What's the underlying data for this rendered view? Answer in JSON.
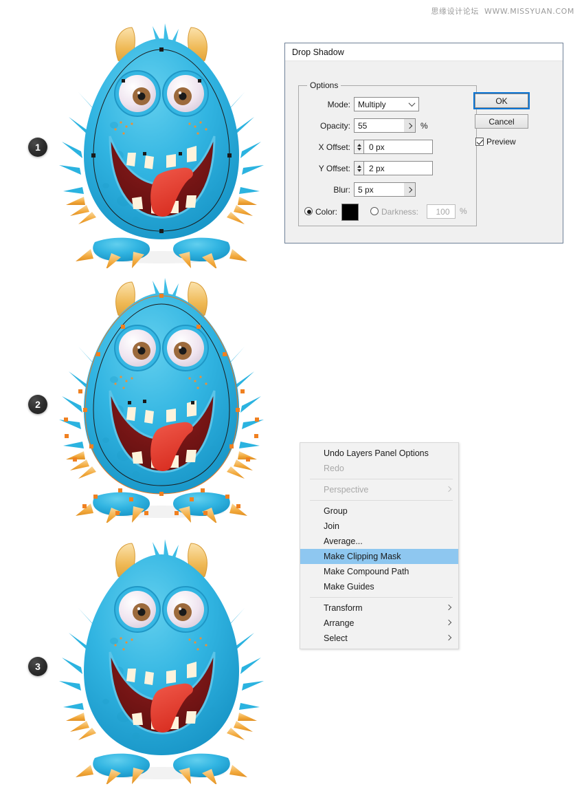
{
  "watermark": {
    "cn": "思缘设计论坛",
    "url": "WWW.MISSYUAN.COM"
  },
  "steps": [
    {
      "number": "1"
    },
    {
      "number": "2"
    },
    {
      "number": "3"
    }
  ],
  "dialog": {
    "title": "Drop Shadow",
    "group_legend": "Options",
    "fields": {
      "mode_label": "Mode:",
      "mode_value": "Multiply",
      "opacity_label": "Opacity:",
      "opacity_value": "55",
      "opacity_unit": "%",
      "xoffset_label": "X Offset:",
      "xoffset_value": "0 px",
      "yoffset_label": "Y Offset:",
      "yoffset_value": "2 px",
      "blur_label": "Blur:",
      "blur_value": "5 px",
      "color_label": "Color:",
      "color_swatch": "#000000",
      "darkness_label": "Darkness:",
      "darkness_value": "100",
      "darkness_unit": "%"
    },
    "buttons": {
      "ok": "OK",
      "cancel": "Cancel",
      "preview": "Preview"
    },
    "accent": "#0a74d4"
  },
  "context_menu": {
    "highlight_color": "#8ec7f0",
    "items": [
      {
        "label": "Undo Layers Panel Options",
        "state": "normal",
        "submenu": false
      },
      {
        "label": "Redo",
        "state": "disabled",
        "submenu": false
      },
      {
        "separator": true
      },
      {
        "label": "Perspective",
        "state": "disabled",
        "submenu": true
      },
      {
        "separator": true
      },
      {
        "label": "Group",
        "state": "normal",
        "submenu": false
      },
      {
        "label": "Join",
        "state": "normal",
        "submenu": false
      },
      {
        "label": "Average...",
        "state": "normal",
        "submenu": false
      },
      {
        "label": "Make Clipping Mask",
        "state": "selected",
        "submenu": false
      },
      {
        "label": "Make Compound Path",
        "state": "normal",
        "submenu": false
      },
      {
        "label": "Make Guides",
        "state": "normal",
        "submenu": false
      },
      {
        "separator": true
      },
      {
        "label": "Transform",
        "state": "normal",
        "submenu": true
      },
      {
        "label": "Arrange",
        "state": "normal",
        "submenu": true
      },
      {
        "label": "Select",
        "state": "normal",
        "submenu": true
      }
    ]
  },
  "artwork": {
    "subject": "blue-furry-monster",
    "colors": {
      "body_light": "#4fc3e8",
      "body_mid": "#2bb3e0",
      "body_dark": "#1a9ac9",
      "horn": "#f0b95a",
      "horn_light": "#f7d89a",
      "claw": "#f2a93c",
      "mouth": "#7a1515",
      "tongue": "#e8362c",
      "tooth": "#fdf3dc",
      "eye_white": "#efe6ef",
      "iris": "#9c6a3c",
      "pupil": "#1a1a1a",
      "freckle": "#e8913a"
    },
    "selection": {
      "path_stroke": "#1a1a1a",
      "anchor_fill": "#1a1a1a",
      "anchor_fill_selected": "#f08020"
    },
    "steps": [
      {
        "number": "1",
        "selection": "body-path-anchors-black"
      },
      {
        "number": "2",
        "selection": "full-artwork-anchors-orange"
      },
      {
        "number": "3",
        "selection": "none"
      }
    ]
  }
}
